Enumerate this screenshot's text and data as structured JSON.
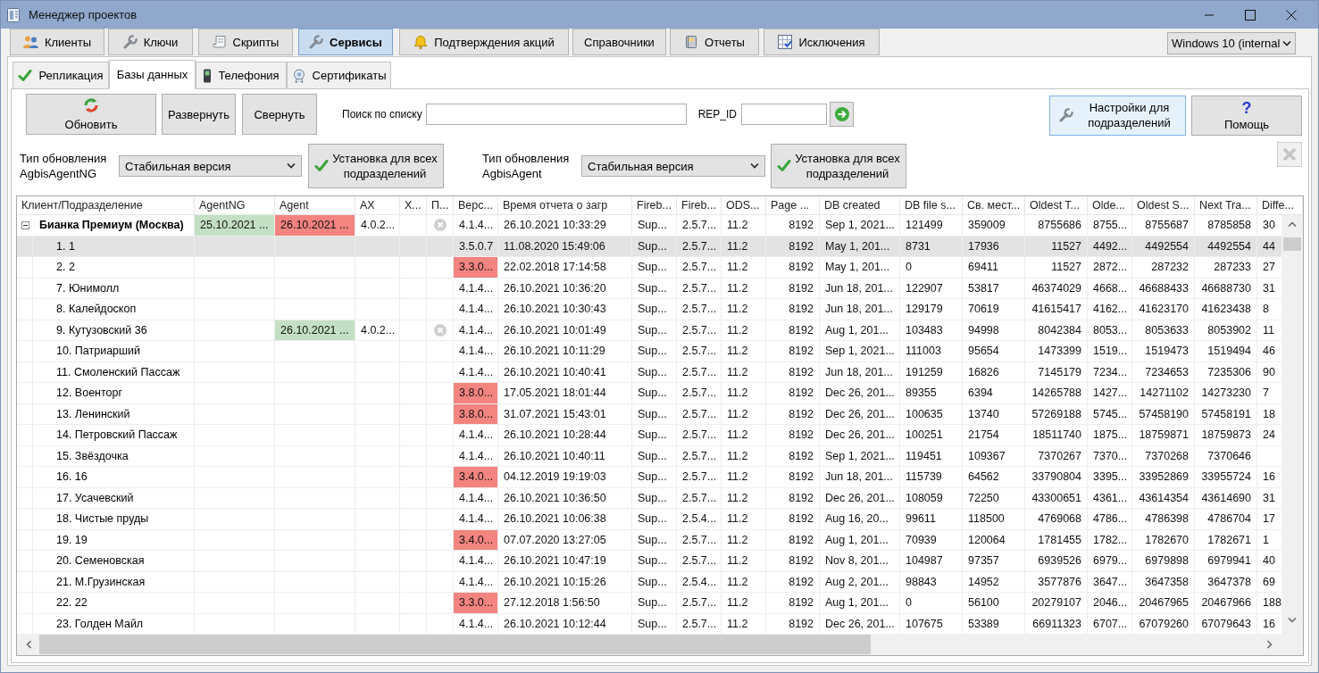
{
  "window": {
    "title": "Менеджер проектов"
  },
  "main_tabs": [
    {
      "label": "Клиенты",
      "selected": false
    },
    {
      "label": "Ключи",
      "selected": false
    },
    {
      "label": "Скрипты",
      "selected": false
    },
    {
      "label": "Сервисы",
      "selected": true
    },
    {
      "label": "Подтверждения акций",
      "selected": false
    },
    {
      "label": "Справочники",
      "selected": false
    },
    {
      "label": "Отчеты",
      "selected": false
    },
    {
      "label": "Исключения",
      "selected": false
    }
  ],
  "os_select": {
    "value": "Windows 10 (internal"
  },
  "sub_tabs": [
    {
      "label": "Репликация",
      "selected": false
    },
    {
      "label": "Базы данных",
      "selected": true
    },
    {
      "label": "Телефония",
      "selected": false
    },
    {
      "label": "Сертификаты",
      "selected": false
    }
  ],
  "toolbar": {
    "refresh_button": "Обновить",
    "expand_button": "Развернуть",
    "collapse_button": "Свернуть",
    "search_label": "Поиск по списку",
    "rep_id_label": "REP_ID",
    "settings_button": {
      "label": "Настройки для подразделений",
      "highlighted": true
    },
    "help_button": {
      "glyph": "?",
      "label": "Помощь",
      "highlighted": false
    }
  },
  "update_types": [
    {
      "label": "Тип обновления AgbisAgentNG",
      "value": "Стабильная версия",
      "button": "Установка для всех подразделений"
    },
    {
      "label": "Тип обновления AgbisAgent",
      "value": "Стабильная версия",
      "button": "Установка для всех подразделений"
    }
  ],
  "delete_button": {
    "disabled": true
  },
  "table": {
    "columns": [
      "Клиент/Подразделение",
      "AgentNG",
      "Agent",
      "AX",
      "Х...",
      "П...",
      "Верс...",
      "Время отчета о загр",
      "Fireb...",
      "Fireb...",
      "ODS...",
      "Page ...",
      "DB created",
      "DB file s...",
      "Св. мест...",
      "Oldest T...",
      "Olde...",
      "Oldest S...",
      "Next Tra...",
      "Diffe..."
    ],
    "rows": [
      {
        "expanded": true,
        "selected": false,
        "p_flag": true,
        "cells": [
          "Бианка Премиум (Москва)",
          {
            "text": "25.10.2021 ...",
            "color": "#c4e0c4"
          },
          {
            "text": "26.10.2021 ...",
            "color": "#f3847f"
          },
          "4.0.2...",
          null,
          null,
          "4.1.4...",
          "26.10.2021 10:33:29",
          "Sup...",
          "2.5.7...",
          "11.2",
          "8192",
          "Sep 1, 2021...",
          "121499",
          "359009",
          "8755686",
          "8755...",
          "8755687",
          "8785858",
          "30"
        ],
        "children": [
          {
            "selected": true,
            "p_flag": false,
            "cells": [
              "1. 1",
              null,
              null,
              null,
              null,
              null,
              "3.5.0.7",
              "11.08.2020 15:49:06",
              "Sup...",
              "2.5.7...",
              "11.2",
              "8192",
              "May 1, 201...",
              "8731",
              "17936",
              "11527",
              "4492...",
              "4492554",
              "4492554",
              "44"
            ]
          },
          {
            "selected": false,
            "p_flag": false,
            "cells": [
              "2. 2",
              null,
              null,
              null,
              null,
              null,
              {
                "text": "3.3.0...",
                "color": "#f3847f"
              },
              "22.02.2018 17:14:58",
              "Sup...",
              "2.5.7...",
              "11.2",
              "8192",
              "May 1, 201...",
              "0",
              "69411",
              "11527",
              "2872...",
              "287232",
              "287233",
              "27"
            ]
          },
          {
            "selected": false,
            "p_flag": false,
            "cells": [
              "7. Юнимолл",
              null,
              null,
              null,
              null,
              null,
              "4.1.4...",
              "26.10.2021 10:36:20",
              "Sup...",
              "2.5.7...",
              "11.2",
              "8192",
              "Jun 18, 201...",
              "122907",
              "53817",
              "46374029",
              "4668...",
              "46688433",
              "46688730",
              "31"
            ]
          },
          {
            "selected": false,
            "p_flag": false,
            "cells": [
              "8. Калейдоскоп",
              null,
              null,
              null,
              null,
              null,
              "4.1.4...",
              "26.10.2021 10:30:43",
              "Sup...",
              "2.5.7...",
              "11.2",
              "8192",
              "Jun 18, 201...",
              "129179",
              "70619",
              "41615417",
              "4162...",
              "41623170",
              "41623438",
              "8"
            ]
          },
          {
            "selected": false,
            "p_flag": true,
            "cells": [
              "9. Кутузовский 36",
              null,
              {
                "text": "26.10.2021 ...",
                "color": "#c4e0c4"
              },
              "4.0.2...",
              null,
              null,
              "4.1.4...",
              "26.10.2021 10:01:49",
              "Sup...",
              "2.5.7...",
              "11.2",
              "8192",
              "Aug 1, 201...",
              "103483",
              "94998",
              "8042384",
              "8053...",
              "8053633",
              "8053902",
              "11"
            ]
          },
          {
            "selected": false,
            "p_flag": false,
            "cells": [
              "10. Патриарший",
              null,
              null,
              null,
              null,
              null,
              "4.1.4...",
              "26.10.2021 10:11:29",
              "Sup...",
              "2.5.7...",
              "11.2",
              "8192",
              "Sep 1, 2021...",
              "111003",
              "95654",
              "1473399",
              "1519...",
              "1519473",
              "1519494",
              "46"
            ]
          },
          {
            "selected": false,
            "p_flag": false,
            "cells": [
              "11. Смоленский Пассаж",
              null,
              null,
              null,
              null,
              null,
              "4.1.4...",
              "26.10.2021 10:40:41",
              "Sup...",
              "2.5.7...",
              "11.2",
              "8192",
              "Jun 18, 201...",
              "191259",
              "16826",
              "7145179",
              "7234...",
              "7234653",
              "7235306",
              "90"
            ]
          },
          {
            "selected": false,
            "p_flag": false,
            "cells": [
              "12. Военторг",
              null,
              null,
              null,
              null,
              null,
              {
                "text": "3.8.0...",
                "color": "#f3847f"
              },
              "17.05.2021 18:01:44",
              "Sup...",
              "2.5.7...",
              "11.2",
              "8192",
              "Dec 26, 201...",
              "89355",
              "6394",
              "14265788",
              "1427...",
              "14271102",
              "14273230",
              "7"
            ]
          },
          {
            "selected": false,
            "p_flag": false,
            "cells": [
              "13. Ленинский",
              null,
              null,
              null,
              null,
              null,
              {
                "text": "3.8.0...",
                "color": "#f3847f"
              },
              "31.07.2021 15:43:01",
              "Sup...",
              "2.5.7...",
              "11.2",
              "8192",
              "Dec 26, 201...",
              "100635",
              "13740",
              "57269188",
              "5745...",
              "57458190",
              "57458191",
              "18"
            ]
          },
          {
            "selected": false,
            "p_flag": false,
            "cells": [
              "14. Петровский Пассаж",
              null,
              null,
              null,
              null,
              null,
              "4.1.4...",
              "26.10.2021 10:28:44",
              "Sup...",
              "2.5.7...",
              "11.2",
              "8192",
              "Dec 26, 201...",
              "100251",
              "21754",
              "18511740",
              "1875...",
              "18759871",
              "18759873",
              "24"
            ]
          },
          {
            "selected": false,
            "p_flag": false,
            "cells": [
              "15. Звёздочка",
              null,
              null,
              null,
              null,
              null,
              "4.1.4...",
              "26.10.2021 10:40:11",
              "Sup...",
              "2.5.7...",
              "11.2",
              "8192",
              "Sep 1, 2021...",
              "119451",
              "109367",
              "7370267",
              "7370...",
              "7370268",
              "7370646",
              null
            ]
          },
          {
            "selected": false,
            "p_flag": false,
            "cells": [
              "16. 16",
              null,
              null,
              null,
              null,
              null,
              {
                "text": "3.4.0...",
                "color": "#f3847f"
              },
              "04.12.2019 19:19:03",
              "Sup...",
              "2.5.7...",
              "11.2",
              "8192",
              "Jun 18, 201...",
              "115739",
              "64562",
              "33790804",
              "3395...",
              "33952869",
              "33955724",
              "16"
            ]
          },
          {
            "selected": false,
            "p_flag": false,
            "cells": [
              "17. Усачевский",
              null,
              null,
              null,
              null,
              null,
              "4.1.4...",
              "26.10.2021 10:36:50",
              "Sup...",
              "2.5.7...",
              "11.2",
              "8192",
              "Dec 26, 201...",
              "108059",
              "72250",
              "43300651",
              "4361...",
              "43614354",
              "43614690",
              "31"
            ]
          },
          {
            "selected": false,
            "p_flag": false,
            "cells": [
              "18. Чистые пруды",
              null,
              null,
              null,
              null,
              null,
              "4.1.4...",
              "26.10.2021 10:06:38",
              "Sup...",
              "2.5.4...",
              "11.2",
              "8192",
              "Aug 16, 20...",
              "99611",
              "118500",
              "4769068",
              "4786...",
              "4786398",
              "4786704",
              "17"
            ]
          },
          {
            "selected": false,
            "p_flag": false,
            "cells": [
              "19. 19",
              null,
              null,
              null,
              null,
              null,
              {
                "text": "3.4.0...",
                "color": "#f3847f"
              },
              "07.07.2020 13:27:05",
              "Sup...",
              "2.5.7...",
              "11.2",
              "8192",
              "Aug 1, 201...",
              "70939",
              "120064",
              "1781455",
              "1782...",
              "1782670",
              "1782671",
              "1"
            ]
          },
          {
            "selected": false,
            "p_flag": false,
            "cells": [
              "20. Семеновская",
              null,
              null,
              null,
              null,
              null,
              "4.1.4...",
              "26.10.2021 10:47:19",
              "Sup...",
              "2.5.7...",
              "11.2",
              "8192",
              "Nov 8, 201...",
              "104987",
              "97357",
              "6939526",
              "6979...",
              "6979898",
              "6979941",
              "40"
            ]
          },
          {
            "selected": false,
            "p_flag": false,
            "cells": [
              "21. М.Грузинская",
              null,
              null,
              null,
              null,
              null,
              "4.1.4...",
              "26.10.2021 10:15:26",
              "Sup...",
              "2.5.4...",
              "11.2",
              "8192",
              "Aug 2, 201...",
              "98843",
              "14952",
              "3577876",
              "3647...",
              "3647358",
              "3647378",
              "69"
            ]
          },
          {
            "selected": false,
            "p_flag": false,
            "cells": [
              "22. 22",
              null,
              null,
              null,
              null,
              null,
              {
                "text": "3.3.0...",
                "color": "#f3847f"
              },
              "27.12.2018 1:56:50",
              "Sup...",
              "2.5.7...",
              "11.2",
              "8192",
              "Aug 1, 201...",
              "0",
              "56100",
              "20279107",
              "2046...",
              "20467965",
              "20467966",
              "188"
            ]
          },
          {
            "selected": false,
            "p_flag": false,
            "cells": [
              "23. Голден Майл",
              null,
              null,
              null,
              null,
              null,
              "4.1.4...",
              "26.10.2021 10:12:44",
              "Sup...",
              "2.5.7...",
              "11.2",
              "8192",
              "Dec 26, 201...",
              "107675",
              "53389",
              "66911323",
              "6707...",
              "67079260",
              "67079643",
              "16"
            ]
          }
        ]
      }
    ]
  }
}
